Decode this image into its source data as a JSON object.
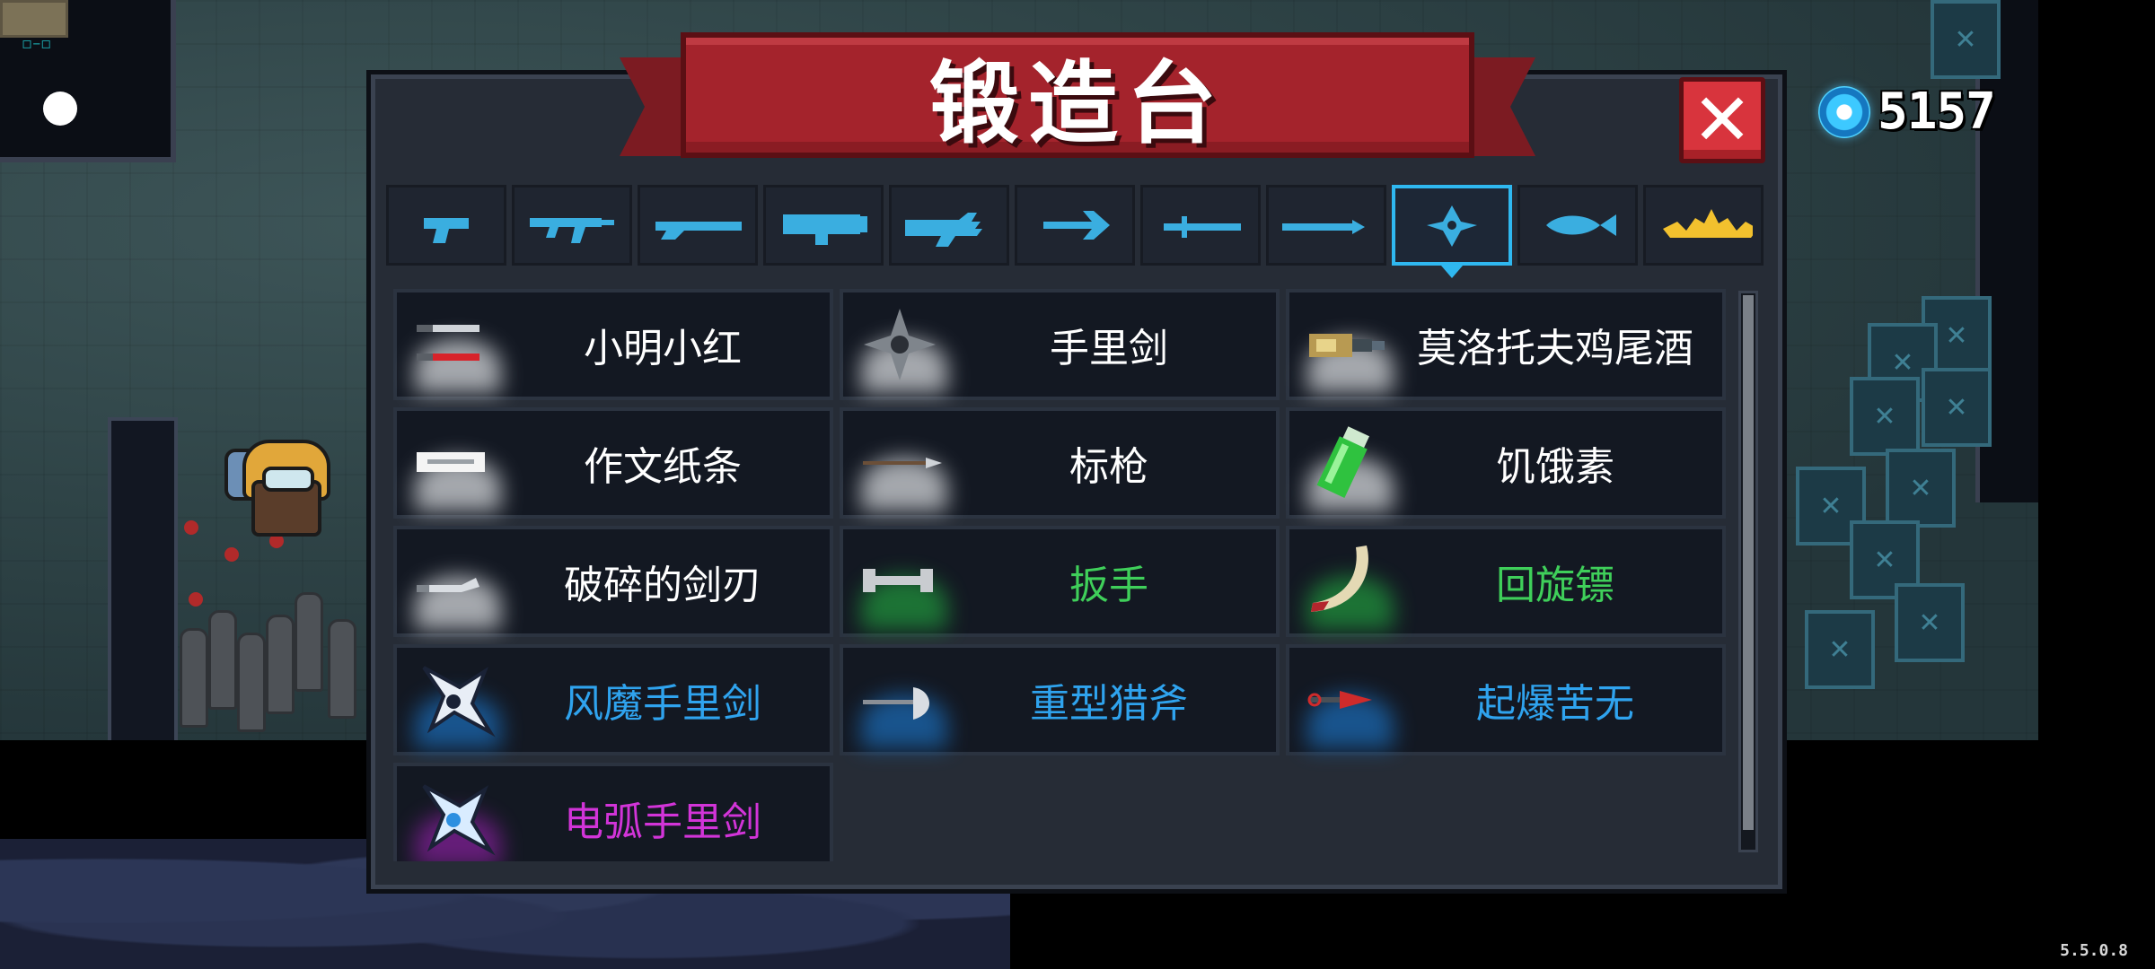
{
  "hud": {
    "coin_count": "5157",
    "version": "5.5.0.8"
  },
  "forge": {
    "title": "锻造台",
    "close_label": "✕",
    "tabs": [
      {
        "icon": "pistol-icon",
        "color": "#3aaee0"
      },
      {
        "icon": "assault-rifle-icon",
        "color": "#3aaee0"
      },
      {
        "icon": "shotgun-icon",
        "color": "#3aaee0"
      },
      {
        "icon": "launcher-icon",
        "color": "#3aaee0"
      },
      {
        "icon": "laser-gun-icon",
        "color": "#3aaee0"
      },
      {
        "icon": "bow-icon",
        "color": "#3aaee0"
      },
      {
        "icon": "sword-icon",
        "color": "#3aaee0"
      },
      {
        "icon": "spear-icon",
        "color": "#3aaee0"
      },
      {
        "icon": "throwable-icon",
        "color": "#3aaee0",
        "selected": true
      },
      {
        "icon": "fish-icon",
        "color": "#3aaee0"
      },
      {
        "icon": "crown-icon",
        "color": "#f2c12e"
      }
    ],
    "items": [
      {
        "name": "小明小红",
        "icon": "twin-knives-icon",
        "color": "#ffffff"
      },
      {
        "name": "手里剑",
        "icon": "shuriken-icon",
        "color": "#ffffff"
      },
      {
        "name": "莫洛托夫鸡尾酒",
        "icon": "molotov-icon",
        "color": "#ffffff"
      },
      {
        "name": "作文纸条",
        "icon": "paper-strip-icon",
        "color": "#ffffff"
      },
      {
        "name": "标枪",
        "icon": "javelin-icon",
        "color": "#ffffff"
      },
      {
        "name": "饥饿素",
        "icon": "green-vial-icon",
        "color": "#ffffff"
      },
      {
        "name": "破碎的剑刃",
        "icon": "broken-blade-icon",
        "color": "#ffffff"
      },
      {
        "name": "扳手",
        "icon": "wrench-icon",
        "color": "#3fcf5a"
      },
      {
        "name": "回旋镖",
        "icon": "boomerang-icon",
        "color": "#3fcf5a"
      },
      {
        "name": "风魔手里剑",
        "icon": "fuma-shuriken-icon",
        "color": "#2fa3ee"
      },
      {
        "name": "重型猎斧",
        "icon": "hunting-axe-icon",
        "color": "#2fa3ee"
      },
      {
        "name": "起爆苦无",
        "icon": "explosive-kunai-icon",
        "color": "#2fa3ee"
      },
      {
        "name": "电弧手里剑",
        "icon": "arc-shuriken-icon",
        "color": "#d234d8"
      }
    ]
  }
}
